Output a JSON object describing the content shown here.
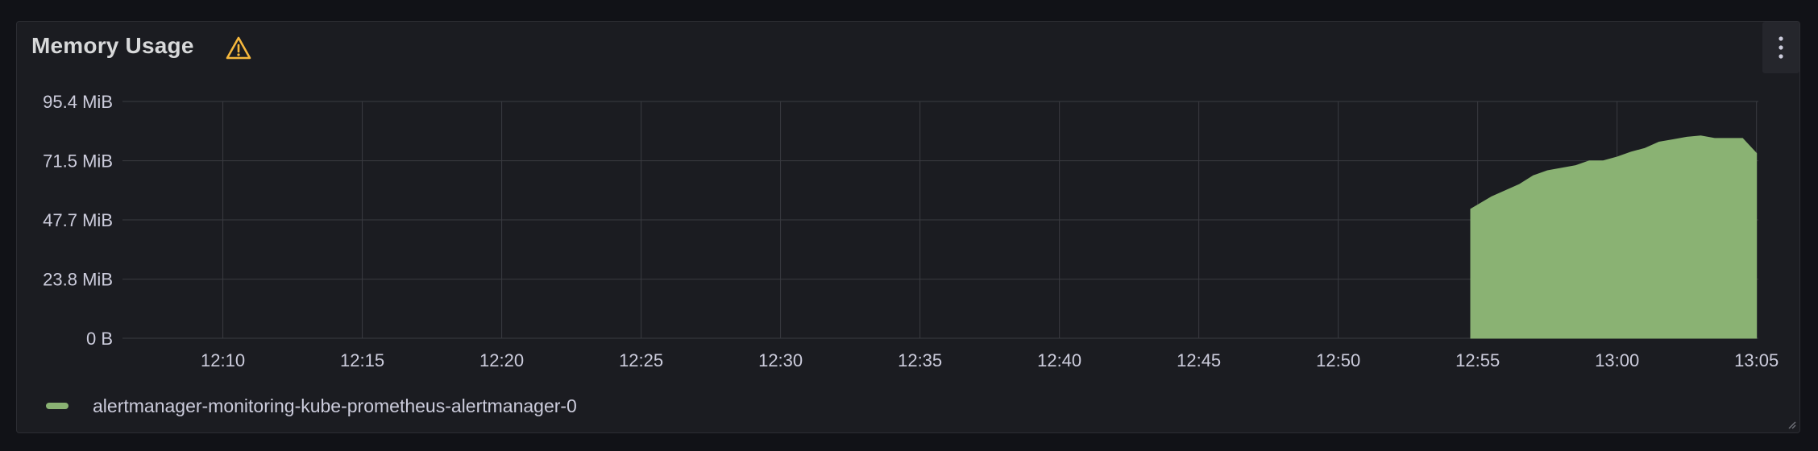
{
  "panel": {
    "title": "Memory Usage",
    "warning_icon": "warning-triangle-icon",
    "menu_icon": "vertical-dots-icon",
    "warning_color": "#f5b73d"
  },
  "legend": {
    "items": [
      {
        "label": "alertmanager-monitoring-kube-prometheus-alertmanager-0",
        "color": "#8ab273"
      }
    ]
  },
  "chart_data": {
    "type": "area",
    "ylim": [
      0,
      95.4
    ],
    "y_ticks": [
      0,
      23.8,
      47.7,
      71.5,
      95.4
    ],
    "y_tick_labels": [
      "0 B",
      "23.8 MiB",
      "47.7 MiB",
      "71.5 MiB",
      "95.4 MiB"
    ],
    "x_ticks": [
      "12:10",
      "12:15",
      "12:20",
      "12:25",
      "12:30",
      "12:35",
      "12:40",
      "12:45",
      "12:50",
      "12:55",
      "13:00",
      "13:05"
    ],
    "xlim": [
      "12:06:24",
      "13:05:04"
    ],
    "grid": true,
    "series": [
      {
        "name": "alertmanager-monitoring-kube-prometheus-alertmanager-0",
        "color": "#8ab273",
        "x": [
          "12:54:45",
          "12:55:30",
          "12:56:30",
          "12:57:00",
          "12:57:30",
          "12:58:00",
          "12:58:30",
          "12:59:00",
          "12:59:30",
          "13:00:00",
          "13:00:30",
          "13:01:00",
          "13:01:30",
          "13:02:00",
          "13:02:30",
          "13:03:00",
          "13:03:30",
          "13:04:00",
          "13:04:30",
          "13:05:00"
        ],
        "values": [
          52,
          57,
          62,
          65.5,
          67.5,
          68.5,
          69.5,
          71.5,
          71.5,
          73,
          75,
          76.5,
          79,
          80,
          81,
          81.5,
          80.5,
          80.5,
          80.5,
          74.5
        ]
      }
    ]
  }
}
